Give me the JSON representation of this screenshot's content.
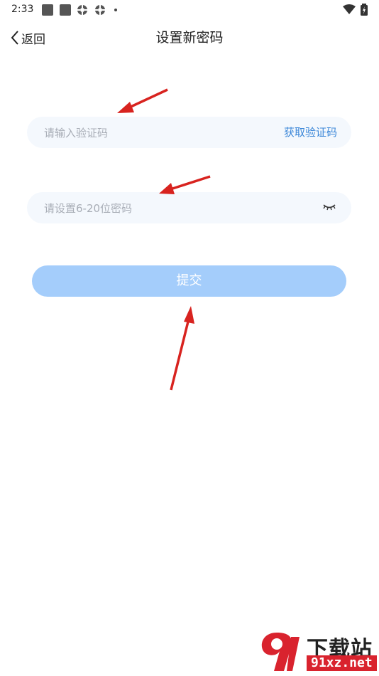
{
  "status_bar": {
    "time": "2:33"
  },
  "header": {
    "back_label": "返回",
    "title": "设置新密码"
  },
  "form": {
    "code_placeholder": "请输入验证码",
    "get_code_label": "获取验证码",
    "password_placeholder": "请设置6-20位密码",
    "submit_label": "提交"
  },
  "colors": {
    "accent": "#3a86d8",
    "submit_disabled": "#a4cdfb",
    "input_bg": "#f4f8fd",
    "annotation_arrow": "#d8231f"
  },
  "watermark": {
    "name": "下载站",
    "url": "91xz.net"
  }
}
